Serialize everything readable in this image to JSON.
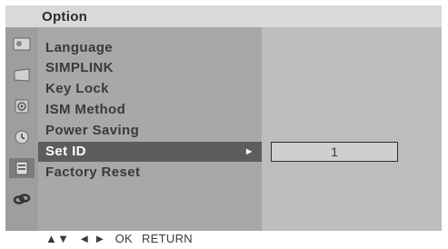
{
  "title": "Option",
  "icons": [
    "picture-icon",
    "screen-icon",
    "speaker-icon",
    "clock-icon",
    "option-icon",
    "lock-icon"
  ],
  "menu": {
    "items": [
      {
        "label": "Language"
      },
      {
        "label": "SIMPLINK"
      },
      {
        "label": "Key Lock"
      },
      {
        "label": "ISM Method"
      },
      {
        "label": "Power Saving"
      },
      {
        "label": "Set ID"
      },
      {
        "label": "Factory Reset"
      }
    ],
    "selected_arrow": "►"
  },
  "value_box": {
    "value": "1"
  },
  "footer": {
    "updown": "▲▼",
    "leftright": "◄ ►",
    "ok": "OK",
    "return": "RETURN"
  }
}
